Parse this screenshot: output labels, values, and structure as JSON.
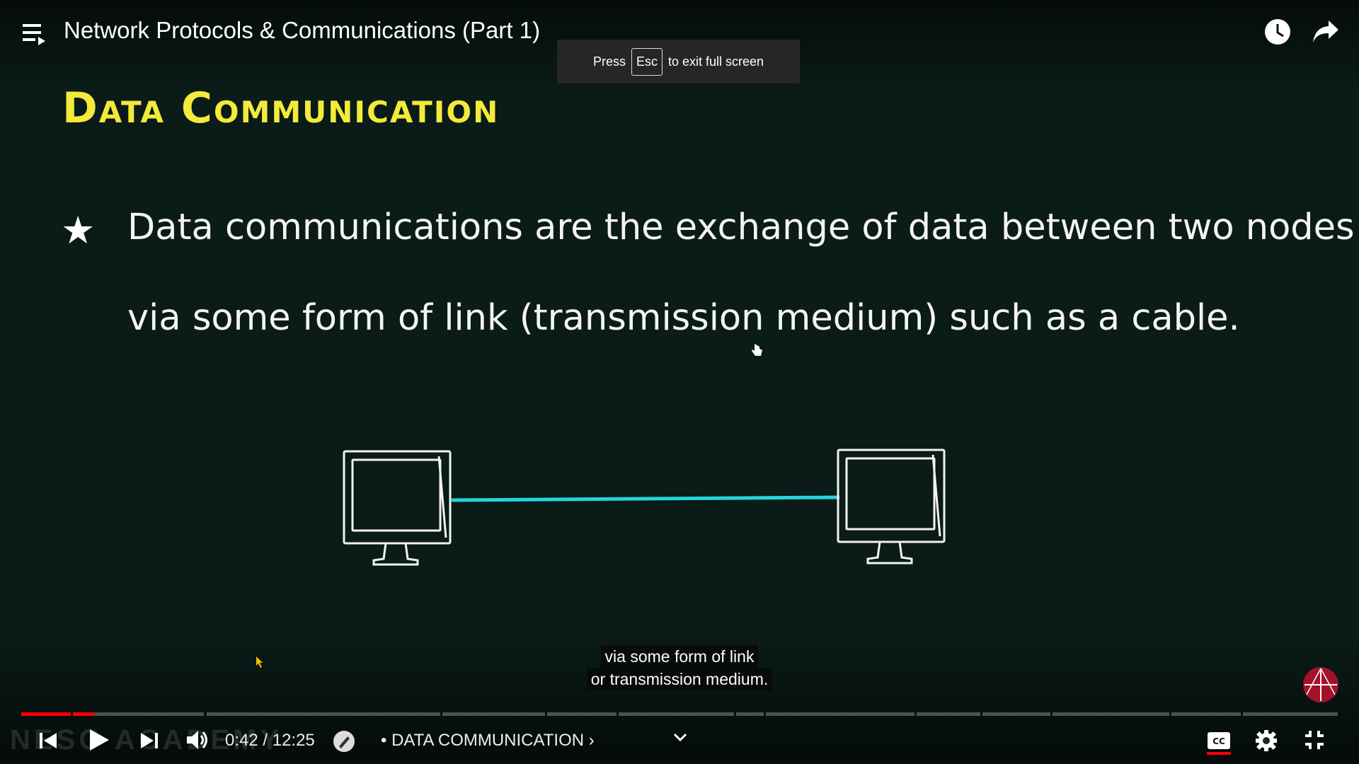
{
  "topbar": {
    "title": "Network Protocols & Communications (Part 1)",
    "icons": [
      "playlist-icon",
      "watch-later-icon",
      "share-icon"
    ]
  },
  "toast": {
    "prefix": "Press",
    "key": "Esc",
    "suffix": "to exit full screen"
  },
  "slide": {
    "title": "Data Communication",
    "bullet_symbol": "★",
    "bullet_line1": "Data communications are the exchange of data between two nodes",
    "bullet_line2": "via some form of link (transmission medium) such as a cable."
  },
  "captions": {
    "line1": "via some form of link",
    "line2": "or transmission medium."
  },
  "watermark": "NESO ACADEMY",
  "player": {
    "time": "0:42 / 12:25",
    "chapter": "• DATA COMMUNICATION ›",
    "progress_played_fraction": 0.056,
    "colors": {
      "accent": "#ff0000",
      "title_yellow": "#f3ea3a",
      "link_cyan": "#27d4d9"
    },
    "icons": [
      "previous-icon",
      "play-icon",
      "next-icon",
      "volume-icon",
      "miniplayer-icon",
      "expand-chevron-icon",
      "cc-icon",
      "settings-icon",
      "exit-fullscreen-icon"
    ]
  }
}
